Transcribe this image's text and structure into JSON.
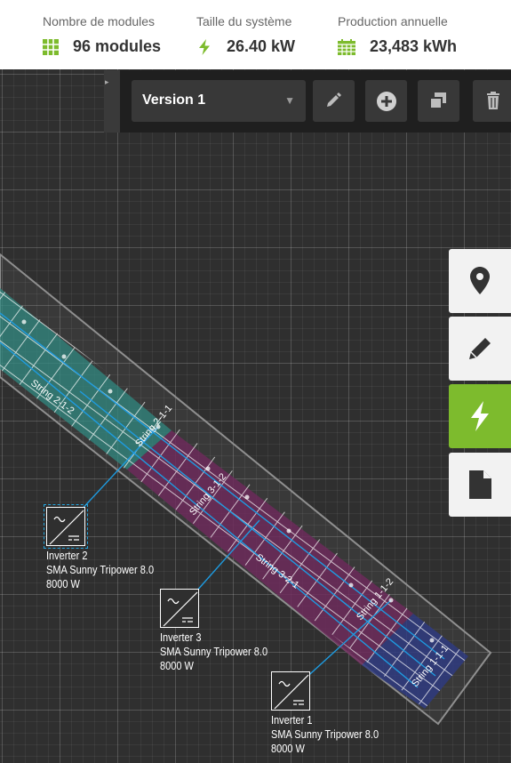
{
  "stats": {
    "modules": {
      "label": "Nombre de modules",
      "value": "96 modules",
      "icon": "module-grid-icon"
    },
    "system_size": {
      "label": "Taille du système",
      "value": "26.40 kW",
      "icon": "lightning-icon"
    },
    "annual_production": {
      "label": "Production annuelle",
      "value": "23,483 kWh",
      "icon": "calendar-icon"
    }
  },
  "toolbar": {
    "collapse_icon": "collapse-arrow-icon",
    "version_select_value": "Version 1",
    "edit_icon": "pencil-icon",
    "add_icon": "plus-circle-icon",
    "duplicate_icon": "duplicate-icon",
    "delete_icon": "trash-icon"
  },
  "side_toolbar": [
    {
      "name": "location",
      "icon": "map-pin-icon",
      "active": false
    },
    {
      "name": "edit",
      "icon": "pencil-icon",
      "active": false
    },
    {
      "name": "electrical",
      "icon": "lightning-icon",
      "active": true
    },
    {
      "name": "report",
      "icon": "document-icon",
      "active": false
    }
  ],
  "strings": [
    "String 2-1-2",
    "String 2-1-1",
    "String 3-1-2",
    "String 3-2-1",
    "String 1-1-2",
    "String 1-1-1"
  ],
  "inverters": [
    {
      "name": "Inverter 2",
      "model": "SMA Sunny Tripower 8.0",
      "power": "8000 W",
      "selected": true
    },
    {
      "name": "Inverter 3",
      "model": "SMA Sunny Tripower 8.0",
      "power": "8000 W",
      "selected": false
    },
    {
      "name": "Inverter 1",
      "model": "SMA Sunny Tripower 8.0",
      "power": "8000 W",
      "selected": false
    }
  ],
  "colors": {
    "accent_green": "#7dbb2d",
    "wire_blue": "#1e9be0",
    "inverter2_zone": "#2f8a82",
    "inverter3_zone": "#6e2a5c",
    "inverter1_zone": "#2e3a82"
  }
}
